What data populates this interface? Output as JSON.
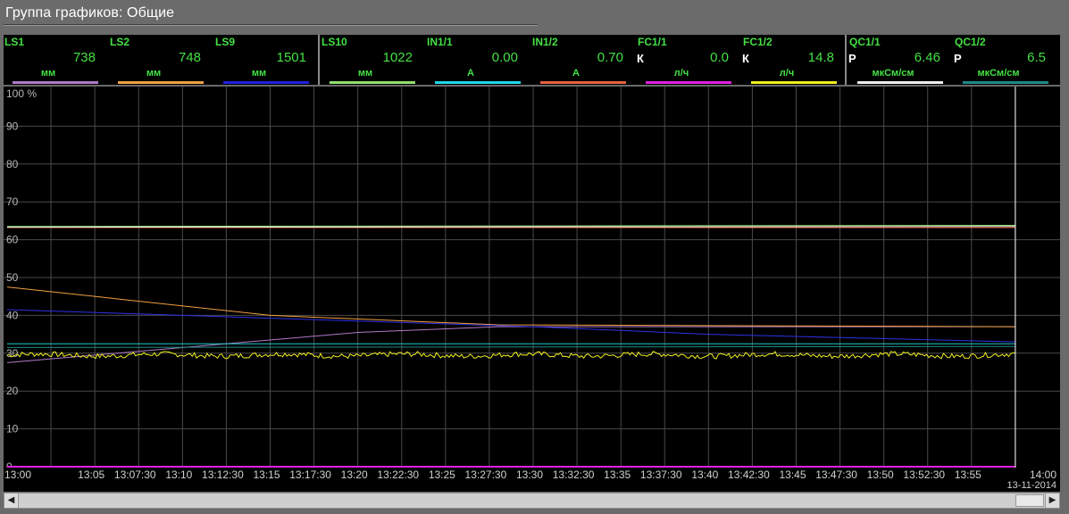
{
  "window": {
    "title": "Группа графиков: Общие"
  },
  "channels": [
    {
      "name": "LS1",
      "value": "738",
      "unit": "мм",
      "flag": "",
      "color": "#b07ac8"
    },
    {
      "name": "LS2",
      "value": "748",
      "unit": "мм",
      "flag": "",
      "color": "#f0a040"
    },
    {
      "name": "LS9",
      "value": "1501",
      "unit": "мм",
      "flag": "",
      "color": "#2020e0"
    },
    {
      "name": "LS10",
      "value": "1022",
      "unit": "мм",
      "flag": "",
      "color": "#90e070"
    },
    {
      "name": "IN1/1",
      "value": "0.00",
      "unit": "A",
      "flag": "",
      "color": "#20d8e8"
    },
    {
      "name": "IN1/2",
      "value": "0.70",
      "unit": "A",
      "flag": "",
      "color": "#e86040"
    },
    {
      "name": "FC1/1",
      "value": "0.0",
      "unit": "л/ч",
      "flag": "К",
      "color": "#e020e0"
    },
    {
      "name": "FC1/2",
      "value": "14.8",
      "unit": "л/ч",
      "flag": "К",
      "color": "#f0f020"
    },
    {
      "name": "QC1/1",
      "value": "6.46",
      "unit": "мкСм/см",
      "flag": "Р",
      "color": "#f0f0f0"
    },
    {
      "name": "QC1/2",
      "value": "6.5",
      "unit": "мкСм/см",
      "flag": "Р",
      "color": "#208888"
    }
  ],
  "chart_data": {
    "type": "line",
    "yunit": "%",
    "ylim": [
      0,
      100
    ],
    "y_ticks": [
      "100 %",
      "90",
      "80",
      "70",
      "60",
      "50",
      "40",
      "30",
      "20",
      "10",
      "0"
    ],
    "x_ticks": [
      "13:00",
      "13:05",
      "13:07:30",
      "13:10",
      "13:12:30",
      "13:15",
      "13:17:30",
      "13:20",
      "13:22:30",
      "13:25",
      "13:27:30",
      "13:30",
      "13:32:30",
      "13:35",
      "13:37:30",
      "13:40",
      "13:42:30",
      "13:45",
      "13:47:30",
      "13:50",
      "13:52:30",
      "13:55",
      "14:00"
    ],
    "date": "13-11-2014",
    "xlim_minutes": [
      0,
      60
    ],
    "grid": true,
    "cursor_at_minutes": 57.5,
    "series": [
      {
        "name": "LS1",
        "color": "#b07ac8",
        "x": [
          0,
          20,
          28,
          57.5
        ],
        "y": [
          27.5,
          35.5,
          37,
          37
        ]
      },
      {
        "name": "LS2",
        "color": "#f0a040",
        "x": [
          0,
          15,
          28,
          57.5
        ],
        "y": [
          47.5,
          40,
          37.5,
          37
        ]
      },
      {
        "name": "LS9",
        "color": "#3030e8",
        "x": [
          0,
          10,
          30,
          40,
          57.5
        ],
        "y": [
          41.5,
          40,
          37,
          35,
          33
        ]
      },
      {
        "name": "LS10",
        "color": "#90e070",
        "x": [
          0,
          57.5
        ],
        "y": [
          63.5,
          63.8
        ]
      },
      {
        "name": "IN1/1",
        "color": "#20c8c8",
        "x": [
          0,
          57.5
        ],
        "y": [
          32.5,
          32.5
        ]
      },
      {
        "name": "IN1/2",
        "color": "#e86040",
        "x": [
          0,
          57.5
        ],
        "y": [
          63.2,
          63.2
        ]
      },
      {
        "name": "FC1/1",
        "color": "#e020e0",
        "x": [
          0,
          57.5
        ],
        "y": [
          0,
          0
        ]
      },
      {
        "name": "FC1/2",
        "color": "#f0f020",
        "x": [
          0,
          57.5
        ],
        "y": [
          29.5,
          29.5
        ]
      },
      {
        "name": "QC1/1",
        "color": "#f0f0f0",
        "x": [
          0,
          57.5
        ],
        "y": [
          63.3,
          63.5
        ]
      },
      {
        "name": "QC1/2",
        "color": "#208888",
        "x": [
          0,
          57.5
        ],
        "y": [
          31.5,
          31.8
        ]
      }
    ]
  },
  "scrollbar": {
    "left_arrow": "◀",
    "right_arrow": "▶"
  }
}
